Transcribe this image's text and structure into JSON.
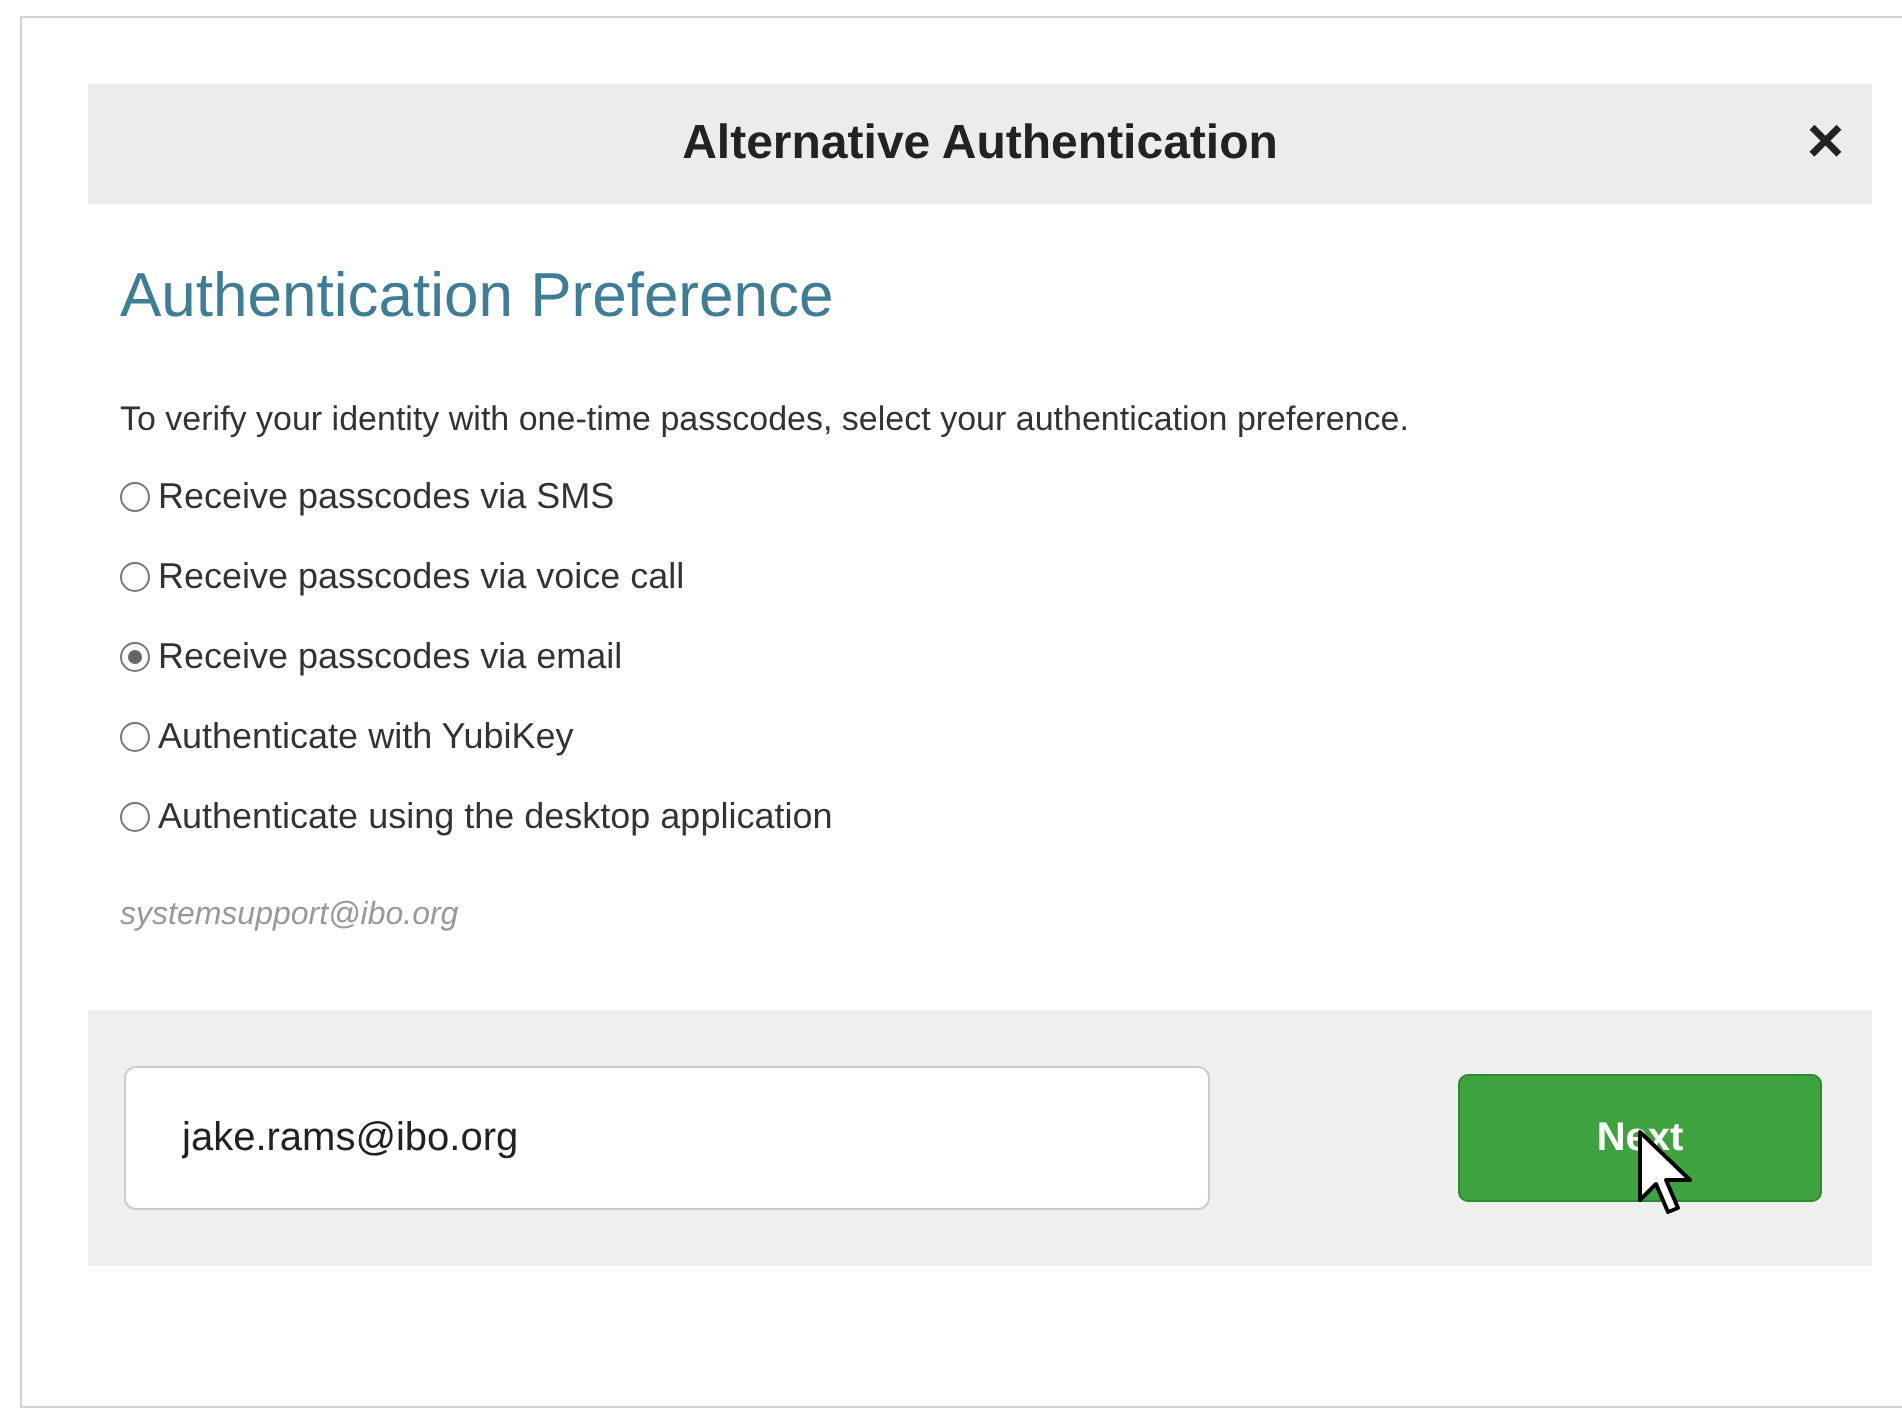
{
  "dialog": {
    "title": "Alternative Authentication",
    "close": "×"
  },
  "heading": "Authentication Preference",
  "instruction": "To verify your identity with one-time passcodes, select your authentication preference.",
  "options": [
    {
      "label": "Receive passcodes via SMS",
      "selected": false
    },
    {
      "label": "Receive passcodes via voice call",
      "selected": false
    },
    {
      "label": "Receive passcodes via email",
      "selected": true
    },
    {
      "label": "Authenticate with YubiKey",
      "selected": false
    },
    {
      "label": "Authenticate using the desktop application",
      "selected": false
    }
  ],
  "hint": "systemsupport@ibo.org",
  "email_field": {
    "value": "jake.rams@ibo.org"
  },
  "next_button": "Next"
}
